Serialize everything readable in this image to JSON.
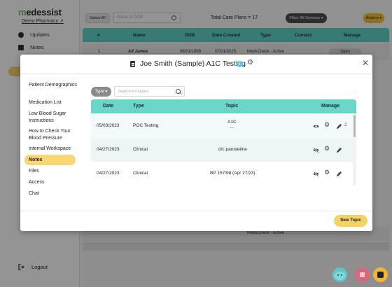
{
  "app": {
    "logo_m": "m",
    "logo_rest": "edessist",
    "pharmacy": "Demo Pharmacy ↗"
  },
  "sidebar": {
    "items": [
      {
        "label": "Updates",
        "icon": "lightbulb-icon"
      },
      {
        "label": "Notes",
        "icon": "notes-icon"
      }
    ],
    "logout": "Logout"
  },
  "toolbar": {
    "select_all": "Select All",
    "search_placeholder": "Name or DOB",
    "total": "Total Care Plans = 17",
    "filter": "Filter: All Services ▾",
    "actions": "Actions ▾"
  },
  "bg_table": {
    "headers": [
      "#",
      "Name",
      "DOB",
      "Date Created",
      "Type",
      "Contact",
      "Manage"
    ],
    "row1": [
      "1",
      "Alf James",
      "06/01/1999",
      "07/01/2025",
      "MedsCheck - Active"
    ],
    "row_bottom_type": "MedsCheck - Active",
    "open": "Open"
  },
  "modal": {
    "title": "Joe Smith (Sample) A1C Testing",
    "info": "i",
    "menu": [
      "Patient Demographics",
      "Medication List",
      "Low Blood Sugar Instructions",
      "How to Check Your Blood Pressure",
      "Internal Workspace",
      "Notes",
      "Files",
      "Access",
      "Chat"
    ],
    "active_menu": "Notes",
    "type_button": "Type ▾",
    "search_placeholder": "Search All Notes",
    "table": {
      "headers": {
        "date": "Date",
        "type": "Type",
        "topic": "Topic",
        "manage": "Manage"
      },
      "rows": [
        {
          "date": "05/03/2023",
          "type": "POC Testing",
          "topic": "A1C",
          "topic_sub": "---",
          "visible": true,
          "count": "2"
        },
        {
          "date": "04/27/2023",
          "type": "Clinical",
          "topic": "d/c paroxetine",
          "topic_sub": "",
          "visible": false,
          "count": ""
        },
        {
          "date": "04/27/2023",
          "type": "Clinical",
          "topic": "BP 157/98 (Apr 27/23)",
          "topic_sub": "",
          "visible": false,
          "count": ""
        }
      ]
    },
    "new_topic": "New Topic"
  },
  "colors": {
    "teal_header": "#6bd5ca",
    "yellow_accent": "#f6d262",
    "overlay": "rgba(0,0,0,0.42)"
  }
}
